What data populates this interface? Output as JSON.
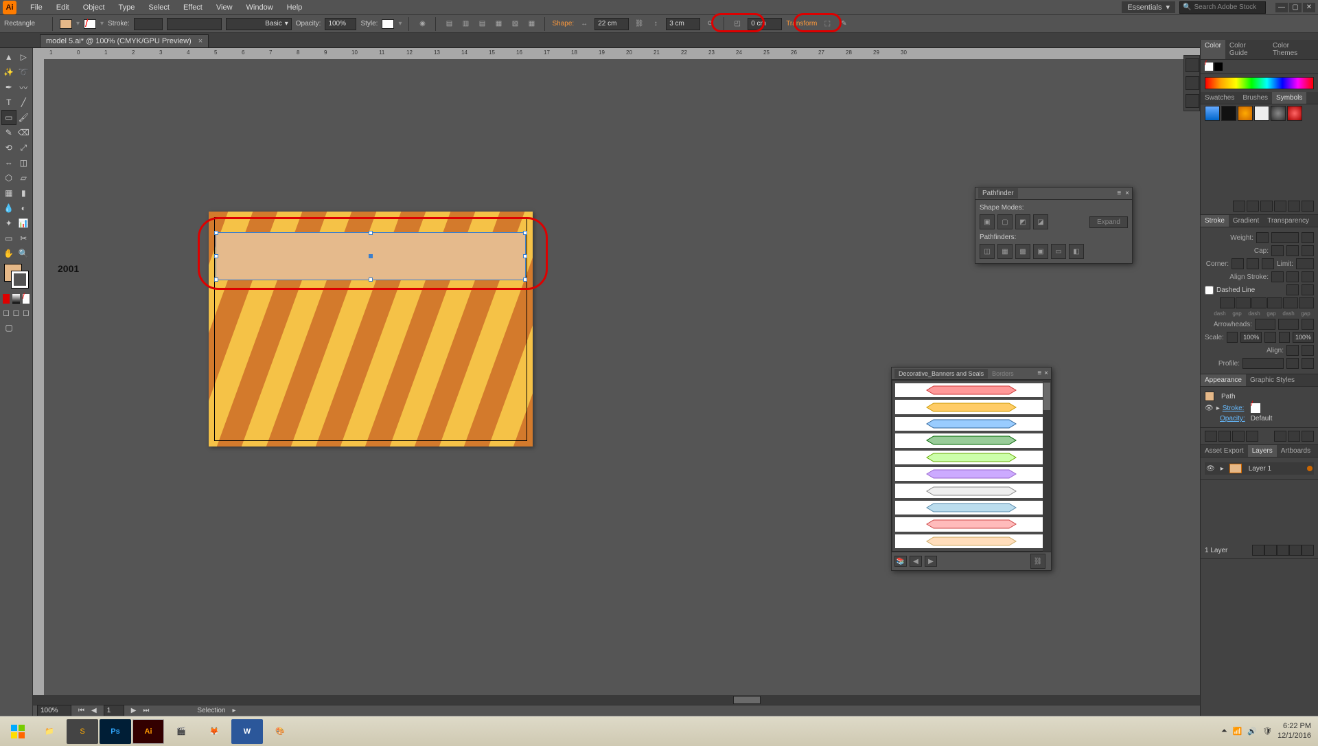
{
  "menubar": {
    "logo": "Ai",
    "items": [
      "File",
      "Edit",
      "Object",
      "Type",
      "Select",
      "Effect",
      "View",
      "Window",
      "Help"
    ],
    "workspace": "Essentials",
    "search_placeholder": "Search Adobe Stock"
  },
  "controlbar": {
    "tool": "Rectangle",
    "fill_color": "#e5b888",
    "stroke_none": "/",
    "stroke_label": "Stroke:",
    "stroke_input": "",
    "stroke_style": "Basic",
    "opacity_label": "Opacity:",
    "opacity_value": "100%",
    "style_label": "Style:",
    "shape_label": "Shape:",
    "width_value": "22 cm",
    "height_value": "3 cm",
    "corner_value": "0 cm",
    "transform_label": "Transform"
  },
  "document": {
    "tab_title": "model 5.ai* @ 100% (CMYK/GPU Preview)",
    "small_label": "2001"
  },
  "pathfinder": {
    "title": "Pathfinder",
    "shape_modes": "Shape Modes:",
    "pathfinders": "Pathfinders:",
    "expand": "Expand"
  },
  "symbols_panel": {
    "title": "Decorative_Banners and Seals",
    "tab2": "Borders"
  },
  "right": {
    "color_tab": "Color",
    "colorguide_tab": "Color Guide",
    "colorthemes_tab": "Color Themes",
    "swatches_tab": "Swatches",
    "brushes_tab": "Brushes",
    "symbols_tab": "Symbols",
    "stroke_tab": "Stroke",
    "gradient_tab": "Gradient",
    "transparency_tab": "Transparency",
    "weight_label": "Weight:",
    "cap_label": "Cap:",
    "corner_label": "Corner:",
    "limit_label": "Limit:",
    "align_stroke_label": "Align Stroke:",
    "dashed_label": "Dashed Line",
    "dash": "dash",
    "gap": "gap",
    "arrowheads_label": "Arrowheads:",
    "scale_label": "Scale:",
    "scale1": "100%",
    "scale2": "100%",
    "align_label": "Align:",
    "profile_label": "Profile:",
    "appearance_tab": "Appearance",
    "graphicstyles_tab": "Graphic Styles",
    "path_label": "Path",
    "stroke_row_label": "Stroke:",
    "opacity_row_label": "Opacity:",
    "opacity_default": "Default",
    "assetexport_tab": "Asset Export",
    "layers_tab": "Layers",
    "artboards_tab": "Artboards",
    "layer1": "Layer 1",
    "layer_count": "1 Layer"
  },
  "status": {
    "zoom": "100%",
    "page": "1",
    "sel": "Selection"
  },
  "taskbar": {
    "time": "6:22 PM",
    "date": "12/1/2016"
  }
}
